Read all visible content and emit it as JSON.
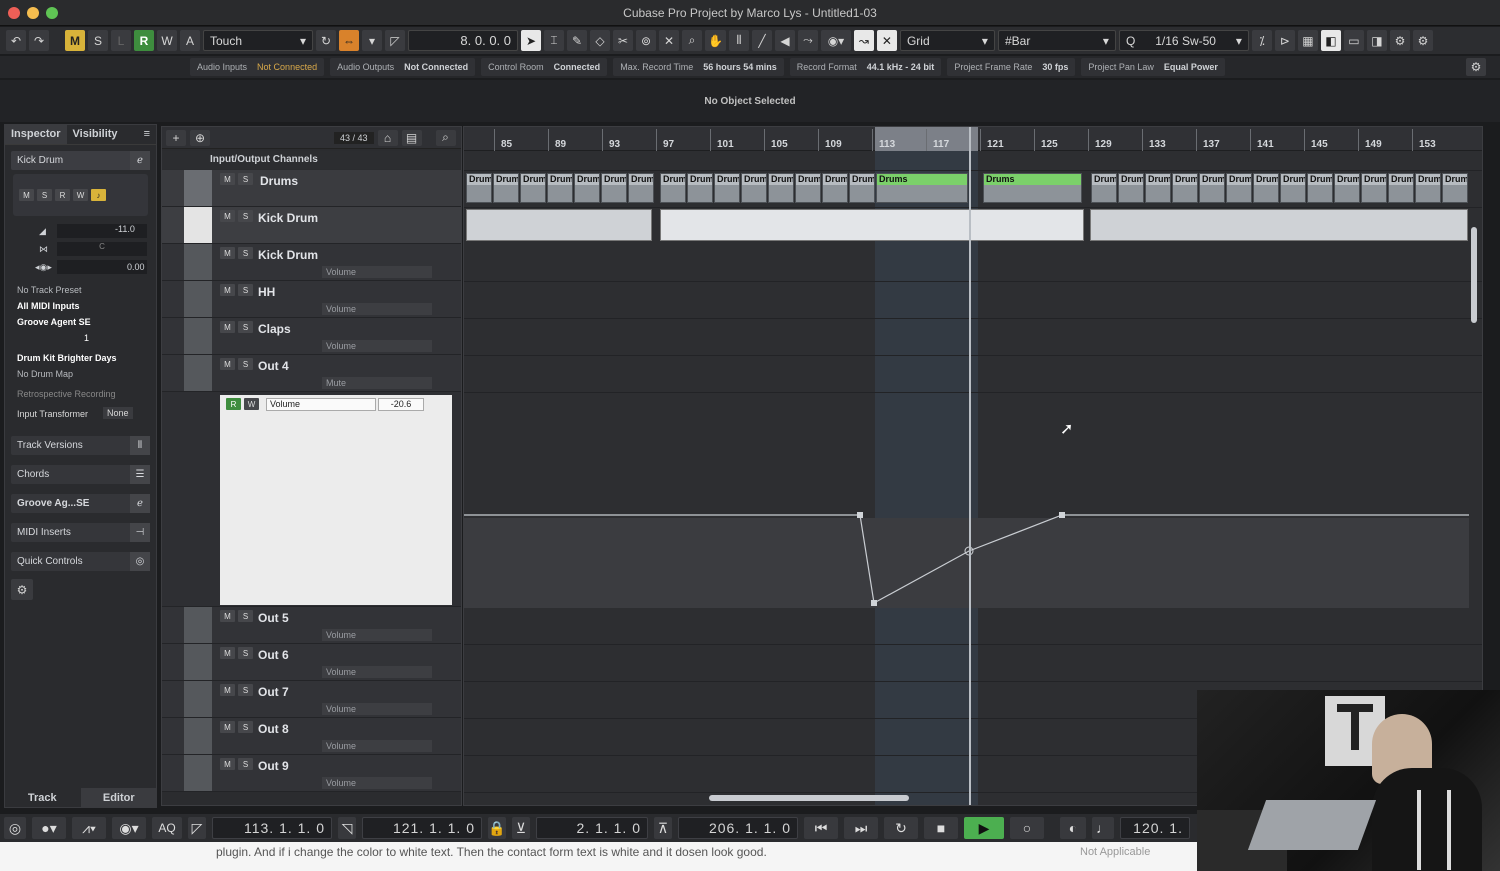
{
  "window": {
    "title": "Cubase Pro Project by Marco Lys - Untitled1-03"
  },
  "toolbar": {
    "undo_icon": "undo-icon",
    "redo_icon": "redo-icon",
    "modes": [
      "M",
      "S",
      "L",
      "R",
      "W",
      "A"
    ],
    "automation_mode": "Touch",
    "position": "8.  0.  0.  0",
    "snap_type": "Grid",
    "grid_type": "Bar",
    "quantize": "1/16  Sw-50"
  },
  "statusbar": {
    "items": [
      {
        "label": "Audio Inputs",
        "value": "Not Connected",
        "warn": true
      },
      {
        "label": "Audio Outputs",
        "value": "Not Connected",
        "warn": false
      },
      {
        "label": "Control Room",
        "value": "Connected",
        "warn": false
      },
      {
        "label": "Max. Record Time",
        "value": "56 hours 54 mins",
        "warn": false
      },
      {
        "label": "Record Format",
        "value": "44.1 kHz - 24 bit",
        "warn": false
      },
      {
        "label": "Project Frame Rate",
        "value": "30 fps",
        "warn": false
      },
      {
        "label": "Project Pan Law",
        "value": "Equal Power",
        "warn": false
      }
    ]
  },
  "infoline": {
    "text": "No Object Selected"
  },
  "inspector": {
    "tabs": [
      "Inspector",
      "Visibility"
    ],
    "track_name": "Kick Drum",
    "volume": "-11.0",
    "pan_label": "C",
    "delay": "0.00",
    "track_preset": "No Track Preset",
    "midi_input": "All MIDI Inputs",
    "instrument": "Groove Agent SE",
    "channel": "1",
    "drum_kit": "Drum Kit Brighter Days",
    "drum_map": "No Drum Map",
    "retro": "Retrospective Recording",
    "input_transformer_label": "Input Transformer",
    "input_transformer_value": "None",
    "sections": [
      "Track Versions",
      "Chords",
      "Groove Ag...SE",
      "MIDI Inserts",
      "Quick Controls"
    ],
    "bottom_tabs": [
      "Track",
      "Editor"
    ]
  },
  "tracklist": {
    "count": "43 / 43",
    "folder_label": "Input/Output Channels",
    "tracks": [
      {
        "name": "Drums",
        "param": ""
      },
      {
        "name": "Kick Drum",
        "param": ""
      },
      {
        "name": "Kick Drum",
        "param": "Volume"
      },
      {
        "name": "HH",
        "param": "Volume"
      },
      {
        "name": "Claps",
        "param": "Volume"
      },
      {
        "name": "Out 4",
        "param": "Mute"
      },
      {
        "name": "Out 5",
        "param": "Volume"
      },
      {
        "name": "Out 6",
        "param": "Volume"
      },
      {
        "name": "Out 7",
        "param": "Volume"
      },
      {
        "name": "Out 8",
        "param": "Volume"
      },
      {
        "name": "Out 9",
        "param": "Volume"
      }
    ],
    "automation_param": "Volume",
    "automation_value": "-20.6"
  },
  "ruler": {
    "bars": [
      "85",
      "89",
      "93",
      "97",
      "101",
      "105",
      "109",
      "113",
      "117",
      "121",
      "125",
      "129",
      "133",
      "137",
      "141",
      "145",
      "149",
      "153"
    ]
  },
  "events": {
    "short_label": "Drum",
    "long_label": "Drums"
  },
  "transport": {
    "left_locator": "113.  1.  1.     0",
    "right_locator": "121.  1.  1.     0",
    "punch_in": "2.  1.  1.     0",
    "punch_out": "206.  1.  1.     0",
    "tempo": "120.  1.",
    "aq_label": "AQ"
  },
  "caption": {
    "text": "plugin. And if i change the color to white text. Then the contact form text is white and it dosen look good.",
    "right": "Not Applicable"
  },
  "colors": {
    "green_event": "#7bd06a",
    "play_green": "#4caf50",
    "accent_yellow": "#d8b33a"
  }
}
